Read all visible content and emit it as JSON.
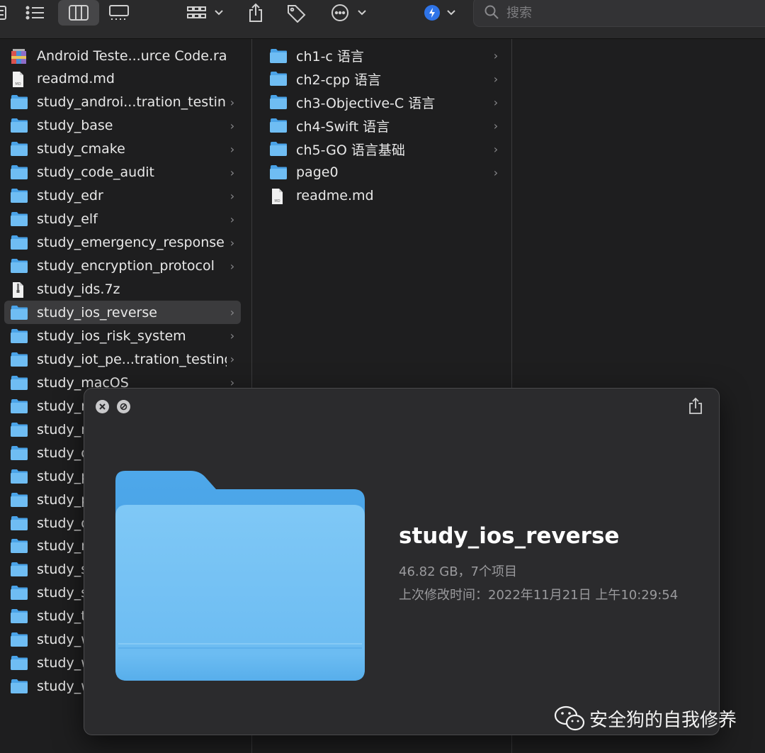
{
  "toolbar": {
    "search_placeholder": "搜索"
  },
  "column1": {
    "items": [
      {
        "label": "Android Teste...urce Code.rar",
        "kind": "rar",
        "chevron": false
      },
      {
        "label": "readmd.md",
        "kind": "md",
        "chevron": false
      },
      {
        "label": "study_androi...tration_testing",
        "kind": "folder",
        "chevron": true
      },
      {
        "label": "study_base",
        "kind": "folder",
        "chevron": true
      },
      {
        "label": "study_cmake",
        "kind": "folder",
        "chevron": true
      },
      {
        "label": "study_code_audit",
        "kind": "folder",
        "chevron": true
      },
      {
        "label": "study_edr",
        "kind": "folder",
        "chevron": true
      },
      {
        "label": "study_elf",
        "kind": "folder",
        "chevron": true
      },
      {
        "label": "study_emergency_response",
        "kind": "folder",
        "chevron": true
      },
      {
        "label": "study_encryption_protocol",
        "kind": "folder",
        "chevron": true
      },
      {
        "label": "study_ids.7z",
        "kind": "7z",
        "chevron": false
      },
      {
        "label": "study_ios_reverse",
        "kind": "folder",
        "chevron": true,
        "selected": true
      },
      {
        "label": "study_ios_risk_system",
        "kind": "folder",
        "chevron": true
      },
      {
        "label": "study_iot_pe...tration_testing",
        "kind": "folder",
        "chevron": true
      },
      {
        "label": "study_macOS",
        "kind": "folder",
        "chevron": true
      },
      {
        "label": "study_m",
        "kind": "folder",
        "chevron": false
      },
      {
        "label": "study_m",
        "kind": "folder",
        "chevron": false
      },
      {
        "label": "study_o",
        "kind": "folder",
        "chevron": false
      },
      {
        "label": "study_p",
        "kind": "folder",
        "chevron": false
      },
      {
        "label": "study_p",
        "kind": "folder",
        "chevron": false
      },
      {
        "label": "study_q",
        "kind": "folder",
        "chevron": false
      },
      {
        "label": "study_r",
        "kind": "folder",
        "chevron": false
      },
      {
        "label": "study_s",
        "kind": "folder",
        "chevron": false
      },
      {
        "label": "study_s",
        "kind": "folder",
        "chevron": false
      },
      {
        "label": "study_t",
        "kind": "folder",
        "chevron": false
      },
      {
        "label": "study_w",
        "kind": "folder",
        "chevron": false
      },
      {
        "label": "study_w",
        "kind": "folder",
        "chevron": false
      },
      {
        "label": "study_w",
        "kind": "folder",
        "chevron": false
      }
    ]
  },
  "column2": {
    "items": [
      {
        "label": "ch1-c 语言",
        "kind": "folder",
        "chevron": true
      },
      {
        "label": "ch2-cpp 语言",
        "kind": "folder",
        "chevron": true
      },
      {
        "label": "ch3-Objective-C 语言",
        "kind": "folder",
        "chevron": true
      },
      {
        "label": "ch4-Swift 语言",
        "kind": "folder",
        "chevron": true
      },
      {
        "label": "ch5-GO 语言基础",
        "kind": "folder",
        "chevron": true
      },
      {
        "label": "page0",
        "kind": "folder",
        "chevron": true
      },
      {
        "label": "readme.md",
        "kind": "md",
        "chevron": false
      }
    ]
  },
  "quicklook": {
    "title": "study_ios_reverse",
    "size_line": "46.82 GB，7个项目",
    "modified_line": "上次修改时间：2022年11月21日 上午10:29:54"
  },
  "watermark": {
    "text": "安全狗的自我修养"
  },
  "colors": {
    "folder_blue": "#4aa3e8",
    "folder_blue_light": "#6fbdf3",
    "selection": "#3b3b3d"
  }
}
